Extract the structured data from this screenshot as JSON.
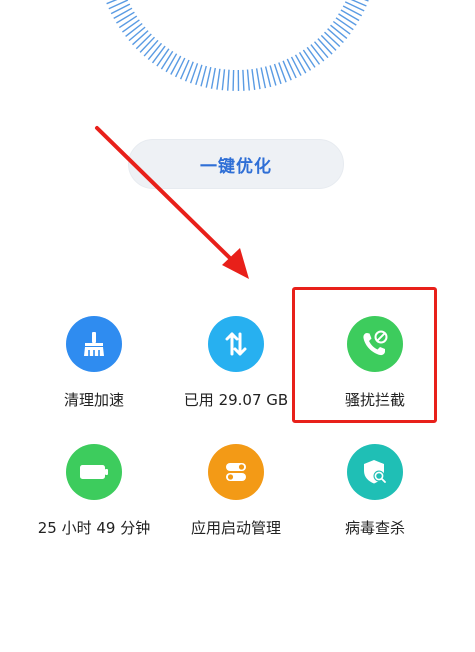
{
  "colors": {
    "accent_blue": "#2f6fd6",
    "tick_blue": "#5a9be3",
    "annotation_red": "#e8201a",
    "blue_icon": "#2f8cf0",
    "cyan_icon": "#27b0f0",
    "green_icon": "#3dcc5d",
    "orange_icon": "#f39a16",
    "teal_icon": "#1fbfb5"
  },
  "optimize_button": {
    "label": "一键优化"
  },
  "tools": [
    {
      "label": "清理加速",
      "icon": "broom-icon"
    },
    {
      "label": "已用 29.07 GB",
      "icon": "up-down-arrows-icon"
    },
    {
      "label": "骚扰拦截",
      "icon": "blocked-call-icon"
    },
    {
      "label": "25 小时 49 分钟",
      "icon": "battery-icon"
    },
    {
      "label": "应用启动管理",
      "icon": "toggle-switches-icon"
    },
    {
      "label": "病毒查杀",
      "icon": "shield-scan-icon"
    }
  ]
}
